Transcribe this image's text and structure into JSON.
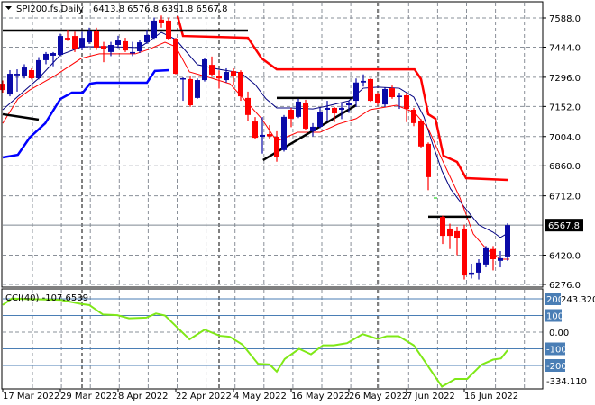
{
  "header": {
    "symbol": "SPI200.fs,Daily",
    "ohlc": "6413.8 6576.8 6391.8 6567.8"
  },
  "cci_header": {
    "label": "CCI(40) -107.6539"
  },
  "colors": {
    "bull": "#0a0aa8",
    "bear": "#ff0000",
    "cci": "#7fe817",
    "level": "#4a7eb5",
    "grid": "#8a9099"
  },
  "chart_data": [
    {
      "type": "candlestick",
      "title": "SPI200.fs,Daily",
      "ylim": [
        6276,
        7588
      ],
      "y_ticks": [
        7588.0,
        7444.0,
        7296.0,
        7152.0,
        7004.0,
        6860.0,
        6712.0,
        6420.0,
        6276.0
      ],
      "y_tick_labels": [
        "7588.0",
        "7444.0",
        "7296.0",
        "7152.0",
        "7004.0",
        "6860.0",
        "6712.0",
        "6420.0",
        "6276.0"
      ],
      "current_price": 6567.8,
      "current_price_label": "6567.8",
      "x_labels": [
        {
          "i": 0,
          "text": "17 Mar 2022"
        },
        {
          "i": 8,
          "text": "29 Mar 2022"
        },
        {
          "i": 16,
          "text": "8 Apr 2022"
        },
        {
          "i": 24,
          "text": "22 Apr 2022"
        },
        {
          "i": 32,
          "text": "4 May 2022"
        },
        {
          "i": 40,
          "text": "16 May 2022"
        },
        {
          "i": 48,
          "text": "26 May 2022"
        },
        {
          "i": 56,
          "text": "7 Jun 2022"
        },
        {
          "i": 64,
          "text": "16 Jun 2022"
        }
      ],
      "candles_ohlc": [
        [
          7264,
          7280,
          7220,
          7233
        ],
        [
          7211,
          7331,
          7202,
          7313
        ],
        [
          7305,
          7335,
          7225,
          7313
        ],
        [
          7300,
          7360,
          7290,
          7344
        ],
        [
          7331,
          7340,
          7285,
          7291
        ],
        [
          7291,
          7395,
          7285,
          7380
        ],
        [
          7380,
          7420,
          7360,
          7411
        ],
        [
          7402,
          7420,
          7350,
          7415
        ],
        [
          7406,
          7510,
          7400,
          7499
        ],
        [
          7490,
          7530,
          7475,
          7482
        ],
        [
          7499,
          7520,
          7420,
          7433
        ],
        [
          7442,
          7520,
          7430,
          7490
        ],
        [
          7468,
          7540,
          7460,
          7522
        ],
        [
          7522,
          7540,
          7430,
          7442
        ],
        [
          7450,
          7470,
          7370,
          7433
        ],
        [
          7420,
          7470,
          7400,
          7455
        ],
        [
          7455,
          7500,
          7440,
          7477
        ],
        [
          7473,
          7490,
          7420,
          7428
        ],
        [
          7415,
          7470,
          7400,
          7420
        ],
        [
          7424,
          7480,
          7415,
          7468
        ],
        [
          7468,
          7530,
          7460,
          7504
        ],
        [
          7490,
          7590,
          7485,
          7575
        ],
        [
          7580,
          7600,
          7540,
          7562
        ],
        [
          7575,
          7590,
          7480,
          7486
        ],
        [
          7486,
          7490,
          7310,
          7313
        ],
        [
          7285,
          7295,
          7180,
          7291
        ],
        [
          7287,
          7300,
          7150,
          7158
        ],
        [
          7194,
          7290,
          7190,
          7282
        ],
        [
          7282,
          7390,
          7275,
          7384
        ],
        [
          7357,
          7398,
          7300,
          7309
        ],
        [
          7300,
          7330,
          7240,
          7290
        ],
        [
          7282,
          7340,
          7270,
          7322
        ],
        [
          7326,
          7340,
          7260,
          7304
        ],
        [
          7322,
          7330,
          7180,
          7202
        ],
        [
          7194,
          7225,
          7080,
          7110
        ],
        [
          7078,
          7100,
          6990,
          6998
        ],
        [
          7003,
          7100,
          6920,
          7012
        ],
        [
          7016,
          7060,
          6990,
          7005
        ],
        [
          7003,
          7030,
          6880,
          6901
        ],
        [
          6937,
          7110,
          6930,
          7101
        ],
        [
          7136,
          7145,
          7050,
          7092
        ],
        [
          7101,
          7190,
          7095,
          7176
        ],
        [
          7167,
          7185,
          7035,
          7043
        ],
        [
          7030,
          7070,
          7005,
          7052
        ],
        [
          7052,
          7145,
          7045,
          7127
        ],
        [
          7136,
          7180,
          7080,
          7145
        ],
        [
          7145,
          7150,
          7075,
          7118
        ],
        [
          7136,
          7170,
          7090,
          7145
        ],
        [
          7158,
          7180,
          7120,
          7171
        ],
        [
          7180,
          7290,
          7150,
          7270
        ],
        [
          7270,
          7310,
          7250,
          7278
        ],
        [
          7287,
          7290,
          7175,
          7180
        ],
        [
          7216,
          7220,
          7160,
          7171
        ],
        [
          7162,
          7245,
          7150,
          7238
        ],
        [
          7242,
          7255,
          7190,
          7198
        ],
        [
          7198,
          7220,
          7140,
          7205
        ],
        [
          7207,
          7220,
          7075,
          7140
        ],
        [
          7136,
          7145,
          7055,
          7070
        ],
        [
          7083,
          7090,
          6950,
          6955
        ],
        [
          6968,
          6975,
          6740,
          6804
        ],
        null,
        [
          6608,
          6615,
          6475,
          6515
        ],
        [
          6551,
          6575,
          6450,
          6515
        ],
        [
          6538,
          6560,
          6420,
          6502
        ],
        [
          6551,
          6570,
          6300,
          6320
        ],
        [
          6330,
          6378,
          6305,
          6334
        ],
        [
          6334,
          6400,
          6300,
          6383
        ],
        [
          6374,
          6465,
          6360,
          6454
        ],
        [
          6450,
          6465,
          6345,
          6400
        ],
        [
          6392,
          6440,
          6360,
          6405
        ],
        [
          6413.8,
          6576.8,
          6391.8,
          6567.8
        ]
      ],
      "overlays": {
        "ma_fast": [
          [
            0,
            7136
          ],
          [
            5,
            7291
          ],
          [
            8,
            7406
          ],
          [
            11,
            7446
          ],
          [
            15,
            7446
          ],
          [
            19,
            7442
          ],
          [
            22,
            7517
          ],
          [
            24,
            7482
          ],
          [
            27,
            7358
          ],
          [
            30,
            7335
          ],
          [
            33,
            7318
          ],
          [
            35,
            7260
          ],
          [
            36.5,
            7190
          ],
          [
            38,
            7145
          ],
          [
            40,
            7145
          ],
          [
            43,
            7140
          ],
          [
            45,
            7154
          ],
          [
            48,
            7180
          ],
          [
            50,
            7242
          ],
          [
            52,
            7247
          ],
          [
            55,
            7242
          ],
          [
            57,
            7198
          ],
          [
            58.4,
            7101
          ],
          [
            59.6,
            6968
          ],
          [
            60.9,
            6835
          ],
          [
            62.1,
            6746
          ],
          [
            64,
            6657
          ],
          [
            66,
            6569
          ],
          [
            68,
            6533
          ],
          [
            69,
            6507
          ],
          [
            70.25,
            6533
          ]
        ],
        "ma_slow": [
          [
            0,
            7069
          ],
          [
            2.1,
            7189
          ],
          [
            3.75,
            7233
          ],
          [
            7.1,
            7300
          ],
          [
            10.9,
            7389
          ],
          [
            13.4,
            7411
          ],
          [
            18.4,
            7411
          ],
          [
            20.25,
            7433
          ],
          [
            22.5,
            7468
          ],
          [
            24,
            7446
          ],
          [
            25.9,
            7322
          ],
          [
            29,
            7291
          ],
          [
            31.5,
            7264
          ],
          [
            34,
            7167
          ],
          [
            35.9,
            7092
          ],
          [
            38,
            6981
          ],
          [
            40.9,
            7025
          ],
          [
            44,
            7025
          ],
          [
            46.5,
            7065
          ],
          [
            49,
            7092
          ],
          [
            50.9,
            7136
          ],
          [
            54.6,
            7158
          ],
          [
            57.1,
            7123
          ],
          [
            59,
            7043
          ],
          [
            60.9,
            6892
          ],
          [
            63.4,
            6702
          ],
          [
            65.25,
            6524
          ],
          [
            67.1,
            6449
          ],
          [
            69,
            6400
          ],
          [
            70.25,
            6400
          ]
        ],
        "lower_band": [
          [
            0,
            6901
          ],
          [
            2.1,
            6914
          ],
          [
            3.75,
            6999
          ],
          [
            5.9,
            7069
          ],
          [
            8,
            7189
          ],
          [
            9.6,
            7220
          ],
          [
            11.1,
            7220
          ],
          [
            12.1,
            7264
          ],
          [
            13,
            7269
          ],
          [
            20,
            7269
          ],
          [
            21.1,
            7327
          ],
          [
            23.1,
            7331
          ]
        ],
        "upper_stop": [
          [
            24.25,
            7597
          ],
          [
            25,
            7499
          ],
          [
            34,
            7490
          ],
          [
            35.9,
            7389
          ],
          [
            38,
            7335
          ],
          [
            57.1,
            7335
          ],
          [
            58,
            7287
          ],
          [
            59,
            7114
          ],
          [
            60,
            7092
          ],
          [
            61.1,
            6910
          ],
          [
            63,
            6879
          ],
          [
            64.25,
            6799
          ],
          [
            70,
            6790
          ]
        ],
        "lines": [
          [
            [
              0,
              7526
            ],
            [
              34,
              7526
            ]
          ],
          [
            [
              0,
              7114
            ],
            [
              5,
              7087
            ]
          ],
          [
            [
              38,
              7194
            ],
            [
              48.6,
              7194
            ]
          ],
          [
            [
              36.1,
              6888
            ],
            [
              49,
              7158
            ]
          ],
          [
            [
              59,
              6609
            ],
            [
              65,
              6609
            ]
          ]
        ]
      }
    },
    {
      "type": "line",
      "title": "CCI(40) -107.6539",
      "ylim": [
        -334.11,
        243.3203
      ],
      "levels": [
        200,
        100,
        -100,
        -200
      ],
      "level_labels": [
        "200",
        "100",
        "-100",
        "-200"
      ],
      "zero_label": "0.00",
      "max_label": "243.3203",
      "min_label": "-334.110",
      "points": [
        [
          0,
          163
        ],
        [
          1.25,
          201
        ],
        [
          8,
          194
        ],
        [
          10.9,
          169
        ],
        [
          12,
          163
        ],
        [
          13.9,
          106
        ],
        [
          15.9,
          102
        ],
        [
          17.5,
          83
        ],
        [
          19.9,
          87
        ],
        [
          21.25,
          112
        ],
        [
          22.5,
          100
        ],
        [
          24.4,
          20
        ],
        [
          25.9,
          -43
        ],
        [
          28,
          15
        ],
        [
          30.1,
          -22
        ],
        [
          31.5,
          -28
        ],
        [
          33.25,
          -75
        ],
        [
          35.4,
          -190
        ],
        [
          37,
          -194
        ],
        [
          38,
          -237
        ],
        [
          39.1,
          -161
        ],
        [
          41.1,
          -100
        ],
        [
          42.75,
          -133
        ],
        [
          44.4,
          -79
        ],
        [
          45.9,
          -79
        ],
        [
          47.75,
          -66
        ],
        [
          49.9,
          -12
        ],
        [
          52,
          -41
        ],
        [
          53.25,
          -24
        ],
        [
          54.9,
          -24
        ],
        [
          57,
          -79
        ],
        [
          60.9,
          -327
        ],
        [
          62.75,
          -281
        ],
        [
          64.4,
          -281
        ],
        [
          66.4,
          -195
        ],
        [
          68,
          -165
        ],
        [
          69.1,
          -158
        ],
        [
          70,
          -108
        ]
      ]
    }
  ]
}
